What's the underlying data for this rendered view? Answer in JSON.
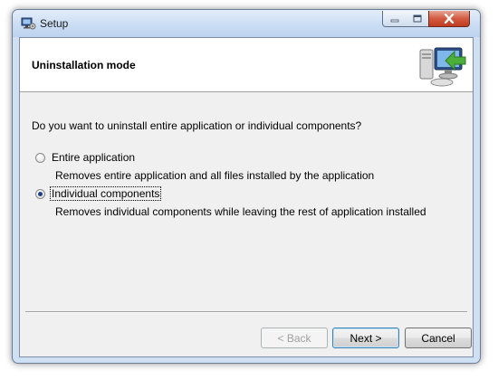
{
  "window": {
    "title": "Setup",
    "icons": {
      "app": "setup-app-icon",
      "minimize": "minimize-icon",
      "maximize": "maximize-icon",
      "close": "close-icon"
    }
  },
  "header": {
    "title": "Uninstallation mode",
    "icon": "computer-uninstall-arrow-icon"
  },
  "body": {
    "question": "Do you want to uninstall entire application or individual components?",
    "options": [
      {
        "label": "Entire application",
        "description": "Removes entire application and all files installed by the application",
        "selected": false
      },
      {
        "label": "Individual components",
        "description": "Removes individual components while leaving the rest of application installed",
        "selected": true
      }
    ]
  },
  "footer": {
    "back_label": "< Back",
    "next_label": "Next >",
    "cancel_label": "Cancel"
  },
  "colors": {
    "frame": "#cfe0f3",
    "close_button": "#c23c22",
    "client_background": "#f0f0f0",
    "radio_dot": "#1f3f86"
  }
}
